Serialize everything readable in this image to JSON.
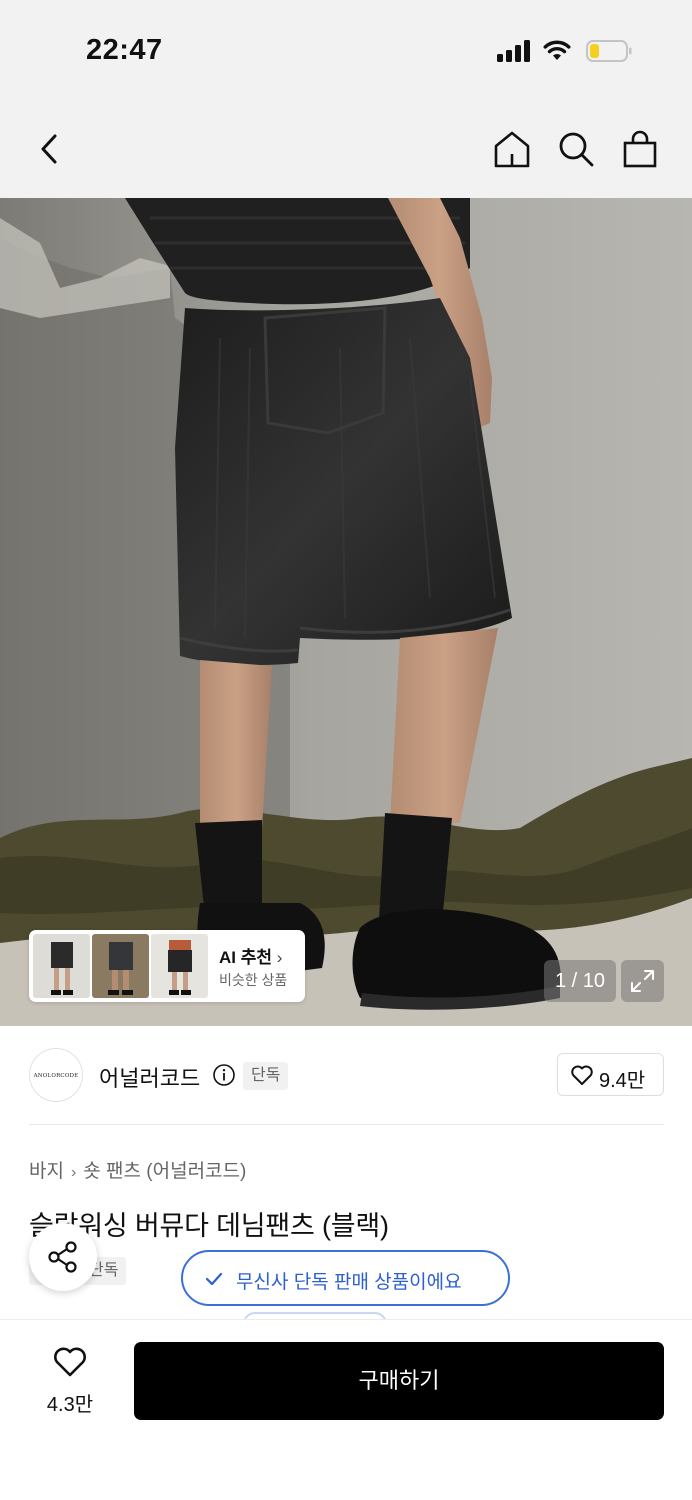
{
  "status_bar": {
    "time": "22:47"
  },
  "nav": {
    "back_icon": "chevron-left-icon",
    "home_icon": "home-icon",
    "search_icon": "search-icon",
    "bag_icon": "shopping-bag-icon"
  },
  "gallery": {
    "current": 1,
    "total": 10,
    "counter_label": "1 / 10",
    "ai_recommend": {
      "title": "AI 추천",
      "subtitle": "비슷한 상품"
    }
  },
  "brand": {
    "logo_text": "ANOLORCODE",
    "name": "어널러코드",
    "tag": "단독",
    "like_count": "9.4만"
  },
  "product": {
    "breadcrumb": [
      "바지",
      "숏 팬츠 (어널러코드)"
    ],
    "title": "슬랍워싱 버뮤다 데님팬츠 (블랙)",
    "tag": "단독"
  },
  "toast": {
    "text": "무신사 단독 판매 상품이에요"
  },
  "bottom_bar": {
    "wish_count": "4.3만",
    "buy_label": "구매하기"
  },
  "colors": {
    "accent_blue": "#2d5fcf",
    "buy_button": "#000000",
    "battery_fill": "#f5d020"
  }
}
